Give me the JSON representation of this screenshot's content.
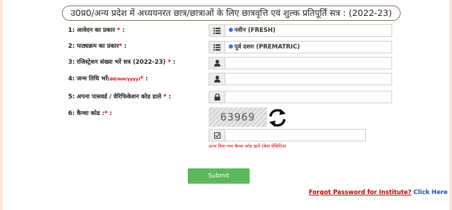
{
  "header": {
    "title": "उ0प्र0/अन्य प्रदेश में अध्ययनरत छात्र/छात्राओं के लिए छात्रवृत्ति एवं शुल्क प्रतिपूर्ति सत्र : (2022-23)"
  },
  "fields": [
    {
      "label": "1: आवेदन का प्रकार",
      "required": " *",
      "suffix": " :",
      "value": "नवीन (FRESH)",
      "icon": "list-icon"
    },
    {
      "label": "2: पाठ्यक्रम का प्रकार",
      "required": "*",
      "suffix": " :",
      "value": "पूर्व दशम (PREMATRIC)",
      "icon": "list-icon"
    },
    {
      "label": "3: रजिस्ट्रेशन संख्या भरें सत्र ",
      "label_bold": "(2022-23)",
      "required": " *",
      "suffix": " :",
      "value": "",
      "icon": "user-icon"
    },
    {
      "label": "4: जन्म तिथि भरें",
      "note": "(dd/mm/yyyy)",
      "required": "*",
      "suffix": " :",
      "value": "",
      "icon": "user-icon"
    },
    {
      "label": "5: अपना पासवर्ड / वेरिफिकेशन कोड डाले",
      "required": " *",
      "suffix": " :",
      "value": "",
      "icon": "lock-icon"
    }
  ],
  "captcha": {
    "label": "6: कैप्चा कोड :",
    "required": "*",
    "suffix": " :",
    "code": "63969",
    "hint": "ऊपर दिया गया कैप्चा कोड डालें (केस सेंसिटिव)"
  },
  "actions": {
    "submit_label": "Submit"
  },
  "forgot": {
    "text": "Forgot Password for Institute?",
    "link": "Click Here"
  },
  "colors": {
    "accent": "#5cb85c",
    "required": "#d10000",
    "link": "#1f4fb0",
    "page_bg": "#fde7d7"
  }
}
